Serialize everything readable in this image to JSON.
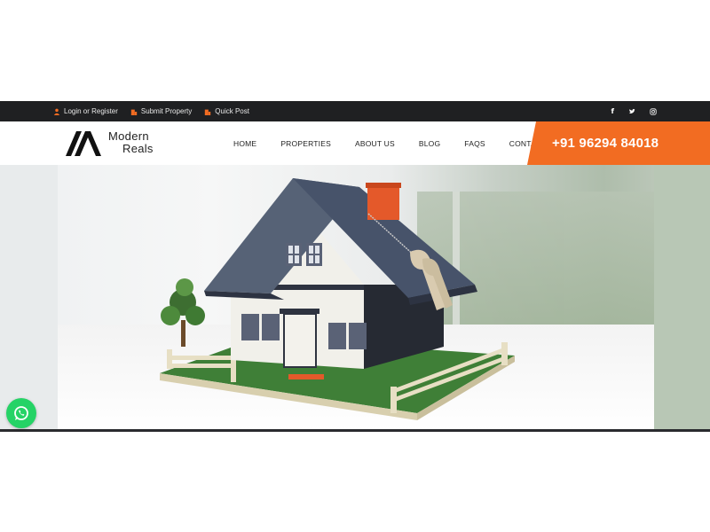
{
  "topbar": {
    "login_label": "Login or Register",
    "submit_label": "Submit Property",
    "quick_post_label": "Quick Post",
    "social": {
      "facebook": "f",
      "twitter": "twitter-icon",
      "instagram": "instagram-icon"
    }
  },
  "brand": {
    "line1": "Modern",
    "line2": "Reals"
  },
  "nav": {
    "items": [
      {
        "label": "HOME"
      },
      {
        "label": "PROPERTIES"
      },
      {
        "label": "ABOUT US"
      },
      {
        "label": "BLOG"
      },
      {
        "label": "FAQS"
      },
      {
        "label": "CONTACT"
      }
    ]
  },
  "phone": {
    "number": "+91 96294 84018"
  },
  "colors": {
    "accent": "#f26c22",
    "topbar": "#1f2022",
    "whatsapp": "#25d366"
  }
}
